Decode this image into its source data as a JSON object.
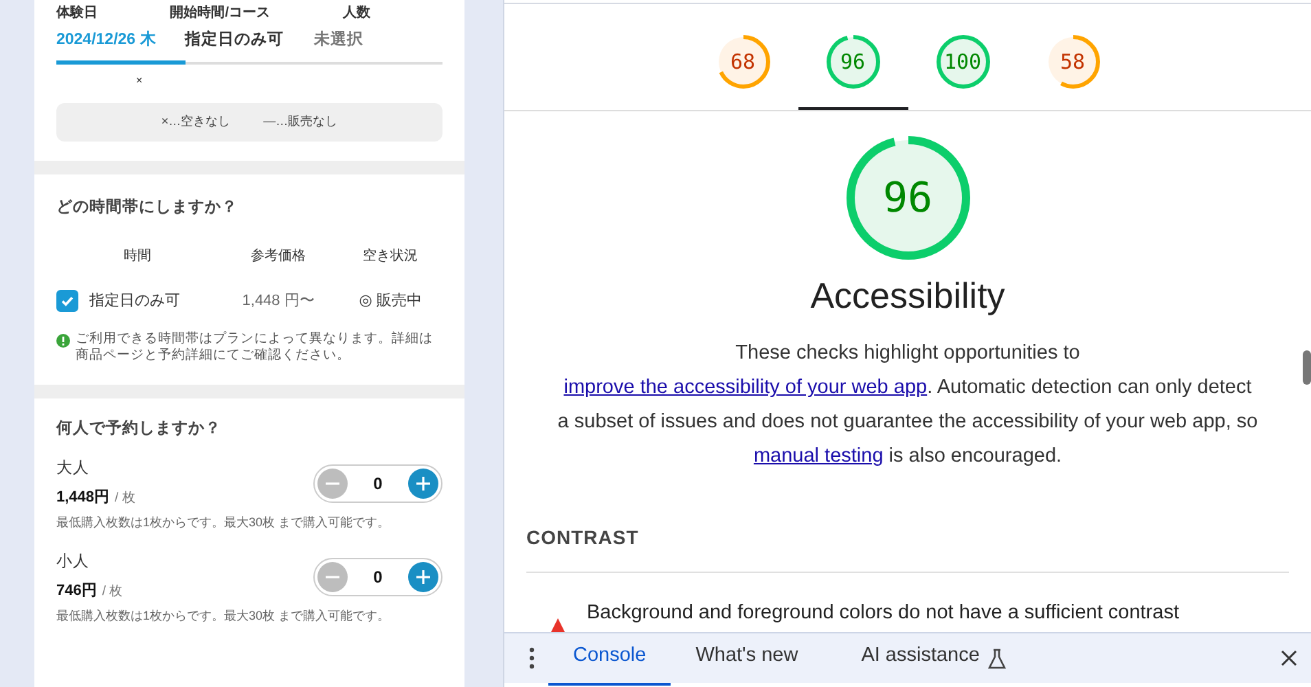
{
  "booking": {
    "summary_labels": [
      "体験日",
      "開始時間/コース",
      "人数"
    ],
    "summary_tabs": [
      {
        "label": "2024/12/26 木",
        "selected": true
      },
      {
        "label": "指定日のみ可",
        "selected": false
      },
      {
        "label": "未選択",
        "selected": false
      }
    ],
    "mark": "×",
    "legend": [
      "×…空きなし",
      "—…販売なし"
    ],
    "time_section": {
      "title": "どの時間帯にしますか？",
      "columns": [
        "時間",
        "参考価格",
        "空き状況"
      ],
      "rows": [
        {
          "checked": true,
          "time": "指定日のみ可",
          "price": "1,448 円〜",
          "availability": "◎ 販売中"
        }
      ],
      "notice": "ご利用できる時間帯はプランによって異なります。詳細は商品ページと予約詳細にてご確認ください。"
    },
    "people_section": {
      "title": "何人で予約しますか？",
      "tickets": [
        {
          "name": "大人",
          "price": "1,448円",
          "unit": "/ 枚",
          "count": "0",
          "note": "最低購入枚数は1枚からです。最大30枚 まで購入可能です。"
        },
        {
          "name": "小人",
          "price": "746円",
          "unit": "/ 枚",
          "count": "0",
          "note": "最低購入枚数は1枚からです。最大30枚 まで購入可能です。"
        }
      ]
    }
  },
  "lighthouse": {
    "scores": [
      {
        "score": "68",
        "level": 0.68,
        "selected": false
      },
      {
        "score": "96",
        "level": 0.96,
        "selected": true
      },
      {
        "score": "100",
        "level": 1,
        "selected": false
      },
      {
        "score": "58",
        "level": 0.58,
        "selected": false
      }
    ],
    "gauge": {
      "score": "96",
      "level": 0.96
    },
    "title": "Accessibility",
    "description": [
      {
        "text": "These checks highlight opportunities to ",
        "link": false
      },
      {
        "text": "improve the accessibility of your web app",
        "link": true
      },
      {
        "text": ". Automatic detection can only detect a subset of issues and does not guarantee the accessibility of your web app, so ",
        "link": false
      },
      {
        "text": "manual testing",
        "link": true
      },
      {
        "text": " is also encouraged.",
        "link": false
      }
    ],
    "group": "CONTRAST",
    "audits": [
      {
        "text": "Background and foreground colors do not have a sufficient contrast"
      }
    ]
  },
  "drawer": {
    "tabs": [
      {
        "label": "Console",
        "selected": true
      },
      {
        "label": "What's new",
        "selected": false
      },
      {
        "label": "AI assistance",
        "selected": false
      }
    ]
  }
}
